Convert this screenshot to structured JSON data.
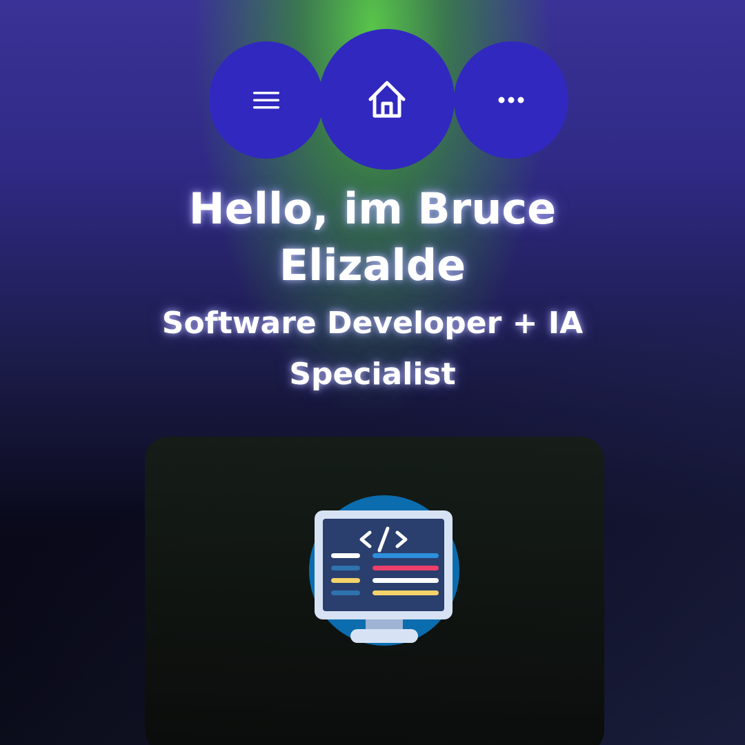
{
  "header": {
    "title": "Hello, im Bruce Elizalde",
    "subtitle": "Software Developer + IA Specialist"
  },
  "nav": {
    "buttons": [
      {
        "icon": "menu-icon"
      },
      {
        "icon": "home-icon"
      },
      {
        "icon": "more-icon"
      }
    ]
  },
  "card": {
    "illustration": "code-monitor-icon"
  },
  "colors": {
    "nav_button": "#3128c0",
    "text": "#ffffff",
    "glow_green": "#5acd46"
  }
}
